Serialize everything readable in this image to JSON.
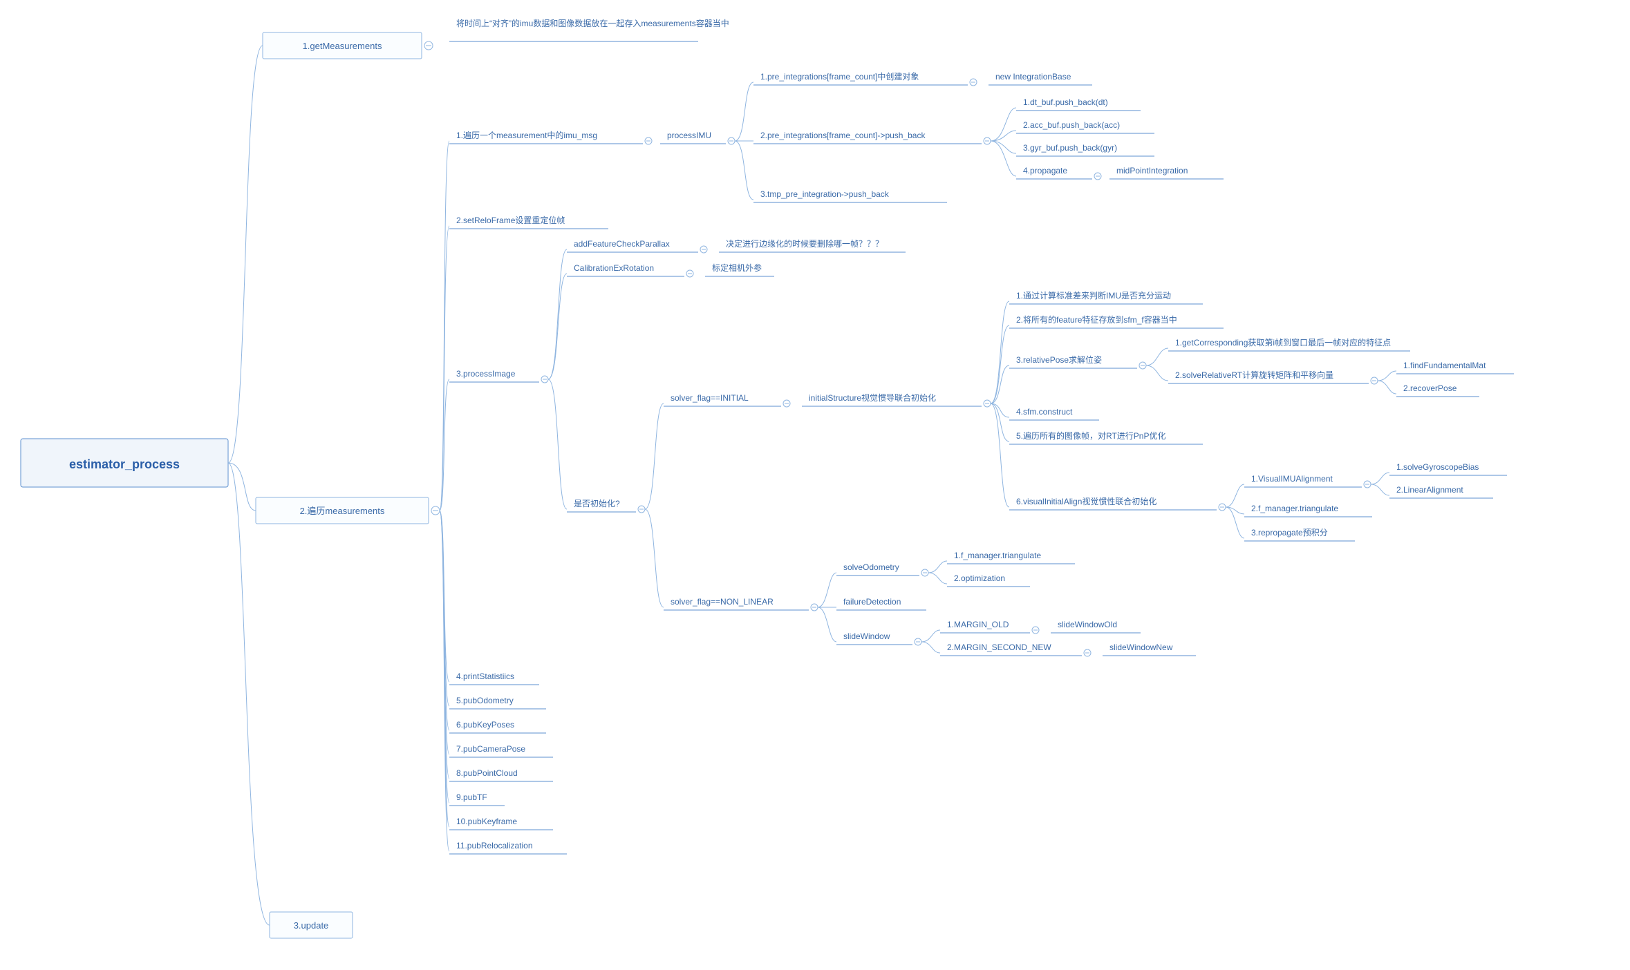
{
  "root": {
    "label": "estimator_process"
  },
  "level1": {
    "n1": {
      "label": "1.getMeasurements",
      "note": "将时间上“对齐”的imu数据和图像数据放在一起存入measurements容器当中"
    },
    "n2": {
      "label": "2.遍历measurements"
    },
    "n3": {
      "label": "3.update"
    }
  },
  "l2": {
    "imu_msg": {
      "label": "1.遍历一个measurement中的imu_msg",
      "child": "processIMU"
    },
    "setRelo": {
      "label": "2.setReloFrame设置重定位帧"
    },
    "processImage": {
      "label": "3.processImage"
    },
    "p4": {
      "label": "4.printStatistiics"
    },
    "p5": {
      "label": "5.pubOdometry"
    },
    "p6": {
      "label": "6.pubKeyPoses"
    },
    "p7": {
      "label": "7.pubCameraPose"
    },
    "p8": {
      "label": "8.pubPointCloud"
    },
    "p9": {
      "label": "9.pubTF"
    },
    "p10": {
      "label": "10.pubKeyframe"
    },
    "p11": {
      "label": "11.pubRelocalization"
    }
  },
  "processIMU": {
    "c1": {
      "label": "1.pre_integrations[frame_count]中创建对象",
      "child": "new IntegrationBase"
    },
    "c2": {
      "label": "2.pre_integrations[frame_count]->push_back"
    },
    "c3": {
      "label": "3.tmp_pre_integration->push_back"
    }
  },
  "pushback": {
    "b1": "1.dt_buf.push_back(dt)",
    "b2": "2.acc_buf.push_back(acc)",
    "b3": "3.gyr_buf.push_back(gyr)",
    "b4": {
      "label": "4.propagate",
      "child": "midPointIntegration"
    }
  },
  "processImage": {
    "afcp": {
      "label": "addFeatureCheckParallax",
      "note": "决定进行边缘化的时候要删除哪一帧？？？"
    },
    "cer": {
      "label": "CalibrationExRotation",
      "note": "标定相机外参"
    },
    "init": {
      "label": "是否初始化?"
    }
  },
  "initbranch": {
    "initial": {
      "label": "solver_flag==INITIAL",
      "child": "initialStructure视觉惯导联合初始化"
    },
    "nonlinear": {
      "label": "solver_flag==NON_LINEAR"
    }
  },
  "initialStructure": {
    "s1": "1.通过计算标准差来判断IMU是否充分运动",
    "s2": "2.将所有的feature特征存放到sfm_f容器当中",
    "s3": {
      "label": "3.relativePose求解位姿"
    },
    "s4": "4.sfm.construct",
    "s5": "5.遍历所有的图像帧，对RT进行PnP优化",
    "s6": {
      "label": "6.visualInitialAlign视觉惯性联合初始化"
    }
  },
  "relativePose": {
    "r1": "1.getCorresponding获取第i帧到窗口最后一帧对应的特征点",
    "r2": {
      "label": "2.solveRelativeRT计算旋转矩阵和平移向量"
    }
  },
  "solveRelativeRT": {
    "f1": "1.findFundamentalMat",
    "f2": "2.recoverPose"
  },
  "visualInitialAlign": {
    "v1": {
      "label": "1.VisualIMUAlignment"
    },
    "v2": "2.f_manager.triangulate",
    "v3": "3.repropagate预积分"
  },
  "VisualIMUAlignment": {
    "a1": "1.solveGyroscopeBias",
    "a2": "2.LinearAlignment"
  },
  "nonlinear": {
    "solveOdo": {
      "label": "solveOdometry"
    },
    "fail": {
      "label": "failureDetection"
    },
    "slide": {
      "label": "slideWindow"
    }
  },
  "solveOdo": {
    "o1": "1.f_manager.triangulate",
    "o2": "2.optimization"
  },
  "slideWindow": {
    "m1": {
      "label": "1.MARGIN_OLD",
      "child": "slideWindowOld"
    },
    "m2": {
      "label": "2.MARGIN_SECOND_NEW",
      "child": "slideWindowNew"
    }
  },
  "chart_data": {
    "type": "tree",
    "title": "estimator_process mind map",
    "root": "estimator_process",
    "children": [
      {
        "name": "1.getMeasurements",
        "note": "将时间上“对齐”的imu数据和图像数据放在一起存入measurements容器当中"
      },
      {
        "name": "2.遍历measurements",
        "children": [
          {
            "name": "1.遍历一个measurement中的imu_msg",
            "children": [
              {
                "name": "processIMU",
                "children": [
                  {
                    "name": "1.pre_integrations[frame_count]中创建对象",
                    "children": [
                      {
                        "name": "new IntegrationBase"
                      }
                    ]
                  },
                  {
                    "name": "2.pre_integrations[frame_count]->push_back",
                    "children": [
                      {
                        "name": "1.dt_buf.push_back(dt)"
                      },
                      {
                        "name": "2.acc_buf.push_back(acc)"
                      },
                      {
                        "name": "3.gyr_buf.push_back(gyr)"
                      },
                      {
                        "name": "4.propagate",
                        "children": [
                          {
                            "name": "midPointIntegration"
                          }
                        ]
                      }
                    ]
                  },
                  {
                    "name": "3.tmp_pre_integration->push_back"
                  }
                ]
              }
            ]
          },
          {
            "name": "2.setReloFrame设置重定位帧"
          },
          {
            "name": "3.processImage",
            "children": [
              {
                "name": "addFeatureCheckParallax",
                "note": "决定进行边缘化的时候要删除哪一帧？？？"
              },
              {
                "name": "CalibrationExRotation",
                "note": "标定相机外参"
              },
              {
                "name": "是否初始化?",
                "children": [
                  {
                    "name": "solver_flag==INITIAL",
                    "children": [
                      {
                        "name": "initialStructure视觉惯导联合初始化",
                        "children": [
                          {
                            "name": "1.通过计算标准差来判断IMU是否充分运动"
                          },
                          {
                            "name": "2.将所有的feature特征存放到sfm_f容器当中"
                          },
                          {
                            "name": "3.relativePose求解位姿",
                            "children": [
                              {
                                "name": "1.getCorresponding获取第i帧到窗口最后一帧对应的特征点"
                              },
                              {
                                "name": "2.solveRelativeRT计算旋转矩阵和平移向量",
                                "children": [
                                  {
                                    "name": "1.findFundamentalMat"
                                  },
                                  {
                                    "name": "2.recoverPose"
                                  }
                                ]
                              }
                            ]
                          },
                          {
                            "name": "4.sfm.construct"
                          },
                          {
                            "name": "5.遍历所有的图像帧，对RT进行PnP优化"
                          },
                          {
                            "name": "6.visualInitialAlign视觉惯性联合初始化",
                            "children": [
                              {
                                "name": "1.VisualIMUAlignment",
                                "children": [
                                  {
                                    "name": "1.solveGyroscopeBias"
                                  },
                                  {
                                    "name": "2.LinearAlignment"
                                  }
                                ]
                              },
                              {
                                "name": "2.f_manager.triangulate"
                              },
                              {
                                "name": "3.repropagate预积分"
                              }
                            ]
                          }
                        ]
                      }
                    ]
                  },
                  {
                    "name": "solver_flag==NON_LINEAR",
                    "children": [
                      {
                        "name": "solveOdometry",
                        "children": [
                          {
                            "name": "1.f_manager.triangulate"
                          },
                          {
                            "name": "2.optimization"
                          }
                        ]
                      },
                      {
                        "name": "failureDetection"
                      },
                      {
                        "name": "slideWindow",
                        "children": [
                          {
                            "name": "1.MARGIN_OLD",
                            "children": [
                              {
                                "name": "slideWindowOld"
                              }
                            ]
                          },
                          {
                            "name": "2.MARGIN_SECOND_NEW",
                            "children": [
                              {
                                "name": "slideWindowNew"
                              }
                            ]
                          }
                        ]
                      }
                    ]
                  }
                ]
              }
            ]
          },
          {
            "name": "4.printStatistiics"
          },
          {
            "name": "5.pubOdometry"
          },
          {
            "name": "6.pubKeyPoses"
          },
          {
            "name": "7.pubCameraPose"
          },
          {
            "name": "8.pubPointCloud"
          },
          {
            "name": "9.pubTF"
          },
          {
            "name": "10.pubKeyframe"
          },
          {
            "name": "11.pubRelocalization"
          }
        ]
      },
      {
        "name": "3.update"
      }
    ]
  }
}
